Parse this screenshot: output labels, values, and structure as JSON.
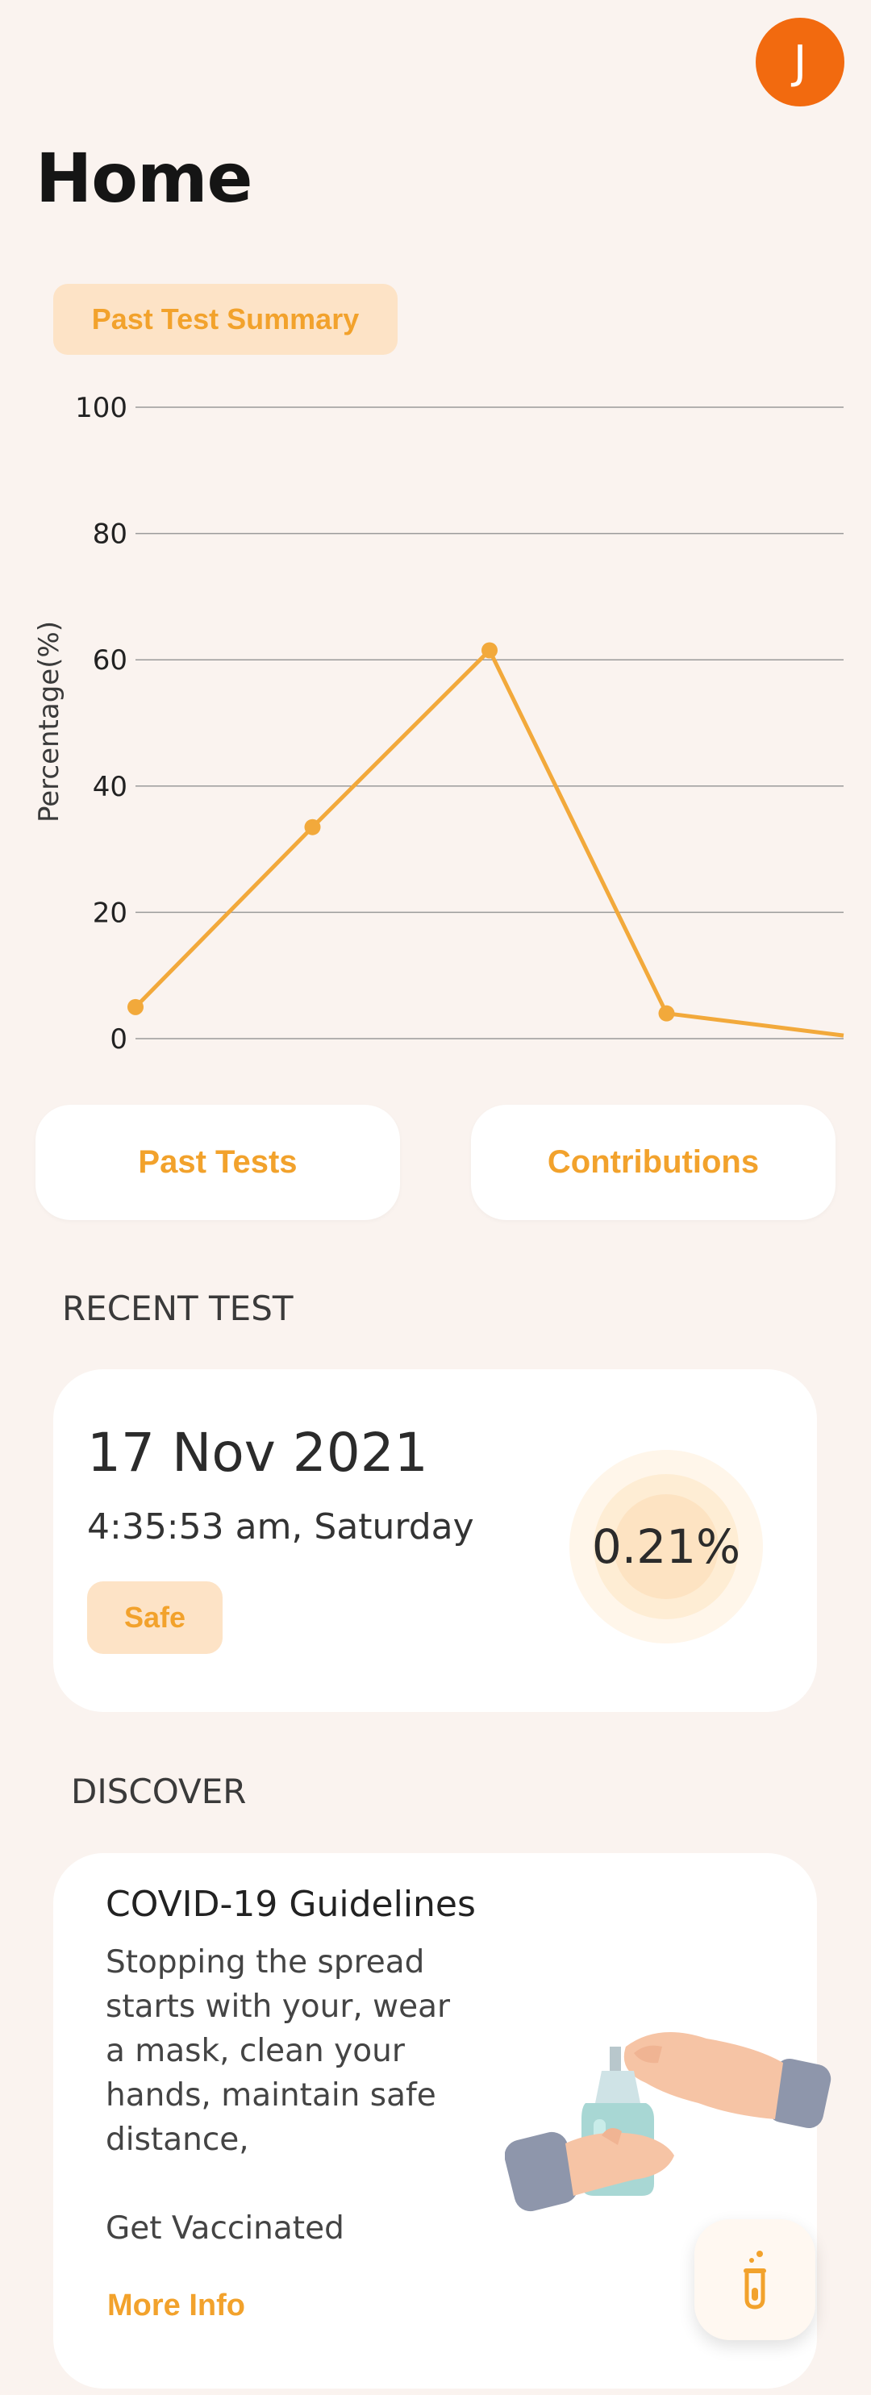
{
  "header": {
    "avatar_initial": "J",
    "title": "Home"
  },
  "summary": {
    "chip_label": "Past Test Summary"
  },
  "chart_data": {
    "type": "line",
    "title": "",
    "xlabel": "",
    "ylabel": "Percentage(%)",
    "ylim": [
      0,
      100
    ],
    "yticks": [
      0,
      20,
      40,
      60,
      80,
      100
    ],
    "x": [
      1,
      2,
      3,
      4,
      5
    ],
    "series": [
      {
        "values": [
          5,
          33.5,
          61.5,
          4,
          0.5
        ]
      }
    ],
    "grid": true,
    "colors": {
      "line": "#f2a93b",
      "grid": "#9a9a9a"
    }
  },
  "buttons": {
    "past_tests": "Past Tests",
    "contributions": "Contributions"
  },
  "recent_test": {
    "heading": "RECENT TEST",
    "date": "17 Nov 2021",
    "time": "4:35:53 am, Saturday",
    "status": "Safe",
    "value": "0.21%"
  },
  "discover": {
    "heading": "DISCOVER",
    "title": "COVID-19 Guidelines",
    "body": "Stopping the spread starts with your, wear a mask, clean your hands, maintain safe distance,",
    "body2": "Get Vaccinated",
    "link": "More Info"
  },
  "fab": {
    "icon": "test-tube-icon"
  },
  "colors": {
    "accent": "#f2a22c",
    "avatar": "#f26a0f",
    "background": "#faf3ef",
    "chip": "#fde3c6"
  }
}
